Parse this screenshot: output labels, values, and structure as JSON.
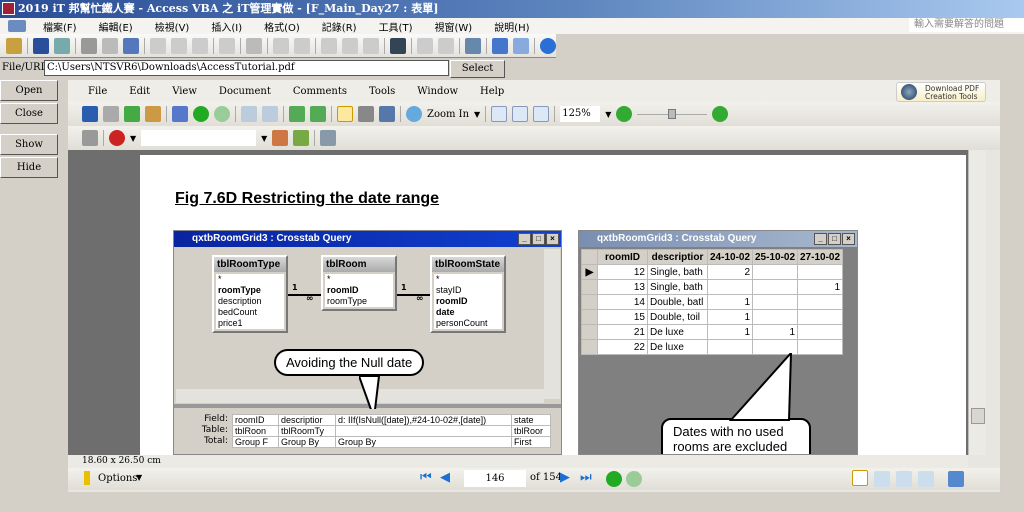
{
  "window_title": "2019 iT 邦幫忙鐵人賽 - Access VBA 之 iT管理實做 - [F_Main_Day27 : 表單]",
  "menu": [
    "檔案(F)",
    "編輯(E)",
    "檢視(V)",
    "插入(I)",
    "格式(O)",
    "記錄(R)",
    "工具(T)",
    "視窗(W)",
    "說明(H)"
  ],
  "help_placeholder": "輸入需要解答的問題",
  "url_row": {
    "label": "File/URL:",
    "value": "C:\\Users\\NTSVR6\\Downloads\\AccessTutorial.pdf",
    "select": "Select"
  },
  "side_buttons": {
    "open": "Open",
    "close": "Close",
    "show": "Show",
    "hide": "Hide"
  },
  "pdf": {
    "menu": [
      "File",
      "Edit",
      "View",
      "Document",
      "Comments",
      "Tools",
      "Window",
      "Help"
    ],
    "zoom_in": "Zoom In",
    "zoom_level": "125%",
    "zoom_slider_fraction": 0.5,
    "download": [
      "Download PDF",
      "Creation Tools"
    ],
    "page_size": "18.60 x 26.50 cm",
    "options": "Options",
    "page": "146",
    "of_pages": "of 154"
  },
  "doc": {
    "fig_title": "Fig 7.6D  Restricting the date range",
    "left_window": {
      "title": "qxtbRoomGrid3 : Crosstab Query",
      "tables": [
        {
          "name": "tblRoomType",
          "fields": [
            "*",
            "roomType",
            "description",
            "bedCount",
            "price1"
          ]
        },
        {
          "name": "tblRoom",
          "fields": [
            "*",
            "roomID",
            "roomType"
          ]
        },
        {
          "name": "tblRoomState",
          "fields": [
            "*",
            "stayID",
            "roomID",
            "date",
            "personCount"
          ]
        }
      ],
      "rel_one": "1",
      "rel_many": "∞",
      "callout": "Avoiding the Null date",
      "grid_labels": [
        "Field:",
        "Table:",
        "Total:"
      ],
      "grid": [
        [
          "roomID",
          "descriptior",
          "d: IIf(IsNull([date]),#24-10-02#,[date])",
          "state"
        ],
        [
          "tblRoon",
          "tblRoomTy",
          "",
          "tblRoor"
        ],
        [
          "Group F",
          "Group By",
          "Group By",
          "First"
        ]
      ]
    },
    "right_window": {
      "title": "qxtbRoomGrid3 : Crosstab Query",
      "headers": [
        "roomID",
        "descriptior",
        "24-10-02",
        "25-10-02",
        "27-10-02"
      ],
      "rows": [
        [
          "12",
          "Single, bath",
          "2",
          "",
          ""
        ],
        [
          "13",
          "Single, bath",
          "",
          "",
          "1"
        ],
        [
          "14",
          "Double, batl",
          "1",
          "",
          ""
        ],
        [
          "15",
          "Double, toil",
          "1",
          "",
          ""
        ],
        [
          "21",
          "De luxe",
          "1",
          "1",
          ""
        ],
        [
          "22",
          "De luxe",
          "",
          "",
          ""
        ]
      ],
      "callout": "Dates with no used rooms are excluded"
    }
  }
}
